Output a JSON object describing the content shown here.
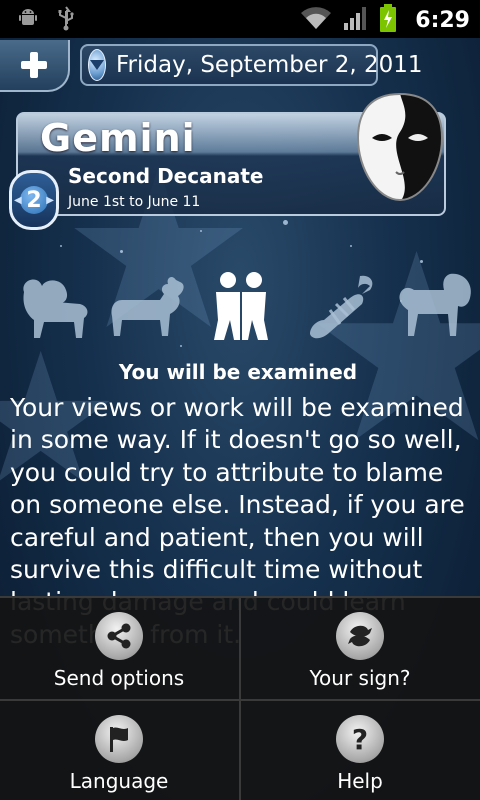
{
  "status_bar": {
    "time": "6:29",
    "icons": [
      "android-debug-icon",
      "usb-icon",
      "wifi-icon",
      "signal-icon",
      "battery-charging-icon"
    ]
  },
  "header": {
    "add_icon": "plus-icon",
    "date_arrow_icon": "chevron-down-icon",
    "date": "Friday, September 2, 2011"
  },
  "sign": {
    "name": "Gemini",
    "decanate_number": "2",
    "decanate_title": "Second Decanate",
    "decanate_dates": "June 1st to June 11",
    "mask_icon": "yin-yang-mask-icon"
  },
  "zodiac_row": [
    "aries-icon",
    "taurus-icon",
    "gemini-icon",
    "cancer-icon",
    "leo-icon"
  ],
  "horoscope": {
    "title": "You will be examined",
    "body": "Your views or work will be examined in some way. If it doesn't go so well, you could try to attribute to blame on someone else. Instead, if you are careful and patient, then you will survive this difficult time without lasting damage and could learn something from it."
  },
  "menu": {
    "items": [
      {
        "label": "Send options",
        "icon": "share-icon"
      },
      {
        "label": "Your sign?",
        "icon": "pisces-icon"
      },
      {
        "label": "Language",
        "icon": "flag-icon"
      },
      {
        "label": "Help",
        "icon": "question-icon"
      }
    ]
  },
  "colors": {
    "background": "#15304d",
    "menu_background": "#141414",
    "text": "#ffffff"
  }
}
